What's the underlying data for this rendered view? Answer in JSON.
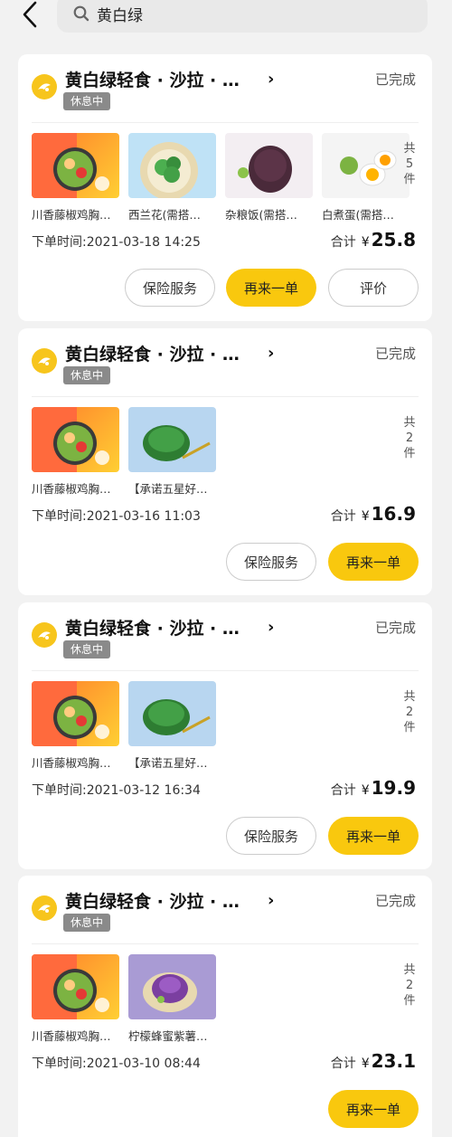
{
  "search": {
    "query": "黄白绿"
  },
  "orders": [
    {
      "shop_name": "黄白绿轻食 · 沙拉 · …",
      "shop_tag": "休息中",
      "status": "已完成",
      "items": [
        {
          "name": "川香藤椒鸡胸…"
        },
        {
          "name": "西兰花(需搭…"
        },
        {
          "name": "杂粮饭(需搭…"
        },
        {
          "name": "白煮蛋(需搭…"
        }
      ],
      "count_chars": [
        "共",
        "5",
        "件"
      ],
      "time_label": "下单时间:",
      "time": "2021-03-18 14:25",
      "total_label": "合计",
      "currency": "¥",
      "amount": "25.8",
      "buttons": [
        "保险服务",
        "再来一单",
        "评价"
      ]
    },
    {
      "shop_name": "黄白绿轻食 · 沙拉 · …",
      "shop_tag": "休息中",
      "status": "已完成",
      "items": [
        {
          "name": "川香藤椒鸡胸…"
        },
        {
          "name": "【承诺五星好…"
        }
      ],
      "count_chars": [
        "共",
        "2",
        "件"
      ],
      "time_label": "下单时间:",
      "time": "2021-03-16 11:03",
      "total_label": "合计",
      "currency": "¥",
      "amount": "16.9",
      "buttons": [
        "保险服务",
        "再来一单"
      ]
    },
    {
      "shop_name": "黄白绿轻食 · 沙拉 · …",
      "shop_tag": "休息中",
      "status": "已完成",
      "items": [
        {
          "name": "川香藤椒鸡胸…"
        },
        {
          "name": "【承诺五星好…"
        }
      ],
      "count_chars": [
        "共",
        "2",
        "件"
      ],
      "time_label": "下单时间:",
      "time": "2021-03-12 16:34",
      "total_label": "合计",
      "currency": "¥",
      "amount": "19.9",
      "buttons": [
        "保险服务",
        "再来一单"
      ]
    },
    {
      "shop_name": "黄白绿轻食 · 沙拉 · …",
      "shop_tag": "休息中",
      "status": "已完成",
      "items": [
        {
          "name": "川香藤椒鸡胸…"
        },
        {
          "name": "柠檬蜂蜜紫薯…"
        }
      ],
      "count_chars": [
        "共",
        "2",
        "件"
      ],
      "time_label": "下单时间:",
      "time": "2021-03-10 08:44",
      "total_label": "合计",
      "currency": "¥",
      "amount": "23.1",
      "buttons": [
        "再来一单"
      ]
    }
  ]
}
